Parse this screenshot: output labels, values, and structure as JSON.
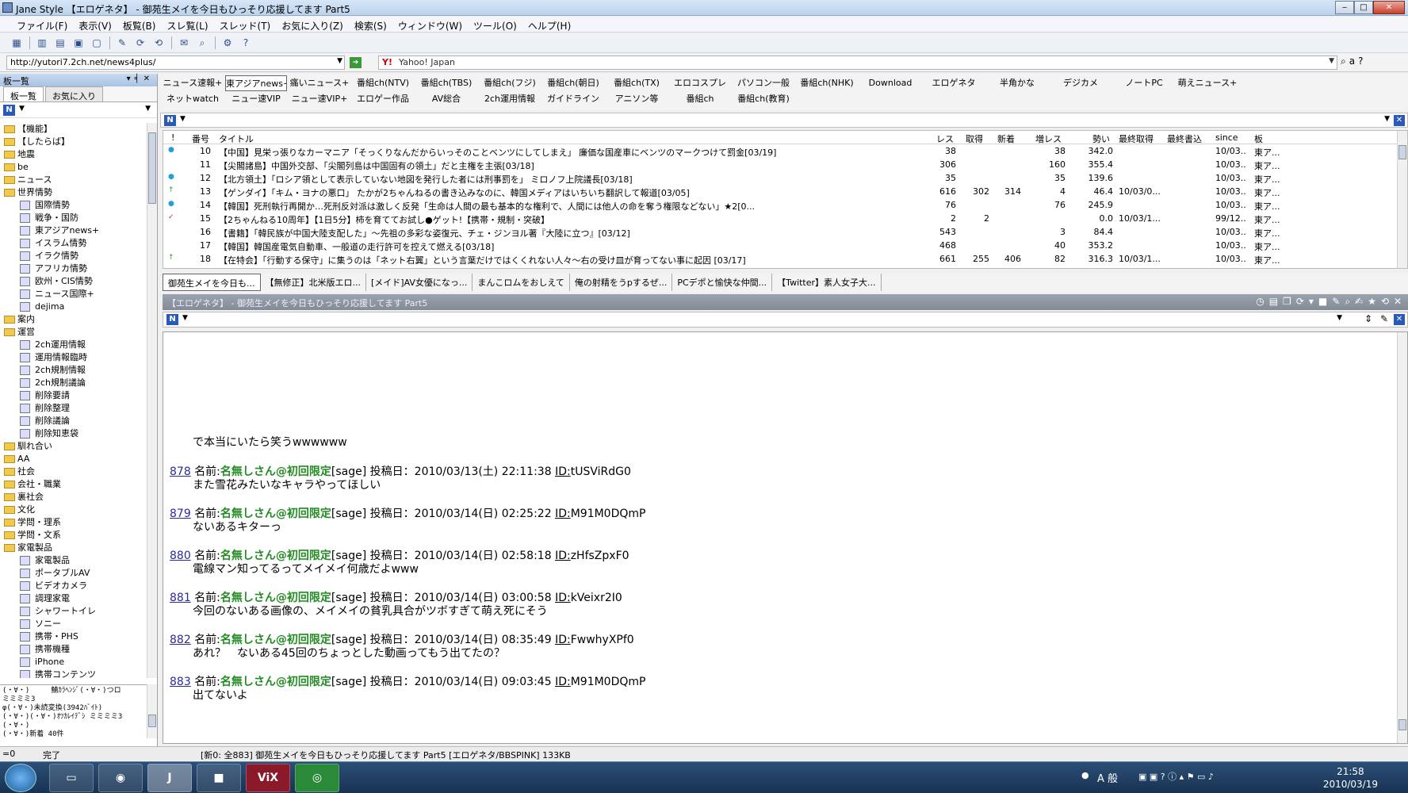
{
  "window": {
    "title": "Jane Style 【エロゲネタ】 - 御苑生メイを今日もひっそり応援してます Part5"
  },
  "menu": [
    "ファイル(F)",
    "表示(V)",
    "板覧(B)",
    "スレ覧(L)",
    "スレッド(T)",
    "お気に入り(Z)",
    "検索(S)",
    "ウィンドウ(W)",
    "ツール(O)",
    "ヘルプ(H)"
  ],
  "address": {
    "url": "http://yutori7.2ch.net/news4plus/",
    "search_engine": "Yahoo! Japan"
  },
  "leftpane": {
    "header": "板一覧",
    "tabs": [
      "板一覧",
      "お気に入り"
    ],
    "tree": [
      {
        "label": "【機能】",
        "level": 0
      },
      {
        "label": "【したらば】",
        "level": 0
      },
      {
        "label": "地震",
        "level": 0
      },
      {
        "label": "be",
        "level": 0
      },
      {
        "label": "ニュース",
        "level": 0
      },
      {
        "label": "世界情勢",
        "level": 0
      },
      {
        "label": "国際情勢",
        "level": 1
      },
      {
        "label": "戦争・国防",
        "level": 1
      },
      {
        "label": "東アジアnews+",
        "level": 1
      },
      {
        "label": "イスラム情勢",
        "level": 1
      },
      {
        "label": "イラク情勢",
        "level": 1
      },
      {
        "label": "アフリカ情勢",
        "level": 1
      },
      {
        "label": "欧州・CIS情勢",
        "level": 1
      },
      {
        "label": "ニュース国際+",
        "level": 1
      },
      {
        "label": "dejima",
        "level": 1
      },
      {
        "label": "案内",
        "level": 0
      },
      {
        "label": "運営",
        "level": 0
      },
      {
        "label": "2ch運用情報",
        "level": 1
      },
      {
        "label": "運用情報臨時",
        "level": 1
      },
      {
        "label": "2ch規制情報",
        "level": 1
      },
      {
        "label": "2ch規制議論",
        "level": 1
      },
      {
        "label": "削除要請",
        "level": 1
      },
      {
        "label": "削除整理",
        "level": 1
      },
      {
        "label": "削除議論",
        "level": 1
      },
      {
        "label": "削除知恵袋",
        "level": 1
      },
      {
        "label": "馴れ合い",
        "level": 0
      },
      {
        "label": "AA",
        "level": 0
      },
      {
        "label": "社会",
        "level": 0
      },
      {
        "label": "会社・職業",
        "level": 0
      },
      {
        "label": "裏社会",
        "level": 0
      },
      {
        "label": "文化",
        "level": 0
      },
      {
        "label": "学問・理系",
        "level": 0
      },
      {
        "label": "学問・文系",
        "level": 0
      },
      {
        "label": "家電製品",
        "level": 0
      },
      {
        "label": "家電製品",
        "level": 1
      },
      {
        "label": "ポータブルAV",
        "level": 1
      },
      {
        "label": "ビデオカメラ",
        "level": 1
      },
      {
        "label": "調理家電",
        "level": 1
      },
      {
        "label": "シャワートイレ",
        "level": 1
      },
      {
        "label": "ソニー",
        "level": 1
      },
      {
        "label": "携帯・PHS",
        "level": 1
      },
      {
        "label": "携帯機種",
        "level": 1
      },
      {
        "label": "iPhone",
        "level": 1
      },
      {
        "label": "携帯コンテンツ",
        "level": 1
      }
    ],
    "log": "(・∀・)     鯖ｶﾗﾍﾝｼﾞ(・∀・)つロ\nミミミミ3\nφ(・∀・)未読変換(3942ﾊﾞｲﾄ)\n(・∀・)(・∀・)ｵﾂｶﾚｲﾃﾞｼ ミミミミ3\n(・∀・)\n(・∀・)新着 40件"
  },
  "board_tabs": {
    "row1": [
      "ニュース速報+",
      "東アジアnews+",
      "痛いニュース+",
      "番組ch(NTV)",
      "番組ch(TBS)",
      "番組ch(フジ)",
      "番組ch(朝日)",
      "番組ch(TX)",
      "エロコスプレ",
      "パソコン一般",
      "番組ch(NHK)",
      "Download",
      "エロゲネタ",
      "半角かな",
      "デジカメ",
      "ノートPC",
      "萌えニュース+"
    ],
    "row2": [
      "ネットwatch",
      "ニュー速VIP",
      "ニュー速VIP+",
      "エロゲー作品",
      "AV総合",
      "2ch運用情報",
      "ガイドライン",
      "アニソン等",
      "番組ch",
      "番組ch(教育)"
    ]
  },
  "threadlist": {
    "columns": {
      "mark": "!",
      "num": "番号",
      "title": "タイトル",
      "res": "レス",
      "got": "取得",
      "new": "新着",
      "inc": "増レス",
      "speed": "勢い",
      "last_get": "最終取得",
      "last_write": "最終書込",
      "since": "since",
      "board": "板"
    },
    "rows": [
      {
        "mark": "●",
        "mark_color": "blue",
        "num": "10",
        "title": "【中国】見栄っ張りなカーマニア「そっくりなんだからいっそのことベンツにしてしまえ」 廉価な国産車にベンツのマークつけて罰金[03/19]",
        "res": "38",
        "got": "",
        "new": "",
        "inc": "38",
        "speed": "342.0",
        "last_get": "",
        "since": "10/03...",
        "board": "東ア..."
      },
      {
        "mark": "",
        "mark_color": "",
        "num": "11",
        "title": "【尖閣諸島】中国外交部、「尖閣列島は中国固有の領土」だと主権を主張[03/18]",
        "res": "306",
        "got": "",
        "new": "",
        "inc": "160",
        "speed": "355.4",
        "last_get": "",
        "since": "10/03...",
        "board": "東ア..."
      },
      {
        "mark": "●",
        "mark_color": "blue",
        "num": "12",
        "title": "【北方領土】「ロシア領として表示していない地図を発行した者には刑事罰を」 ミロノフ上院議長[03/18]",
        "res": "35",
        "got": "",
        "new": "",
        "inc": "35",
        "speed": "139.6",
        "last_get": "",
        "since": "10/03...",
        "board": "東ア..."
      },
      {
        "mark": "↑",
        "mark_color": "green",
        "num": "13",
        "title": "【ゲンダイ】「キム・ヨナの悪口」 たかが2ちゃんねるの書き込みなのに、韓国メディアはいちいち翻訳して報道[03/05]",
        "res": "616",
        "got": "302",
        "new": "314",
        "inc": "4",
        "speed": "46.4",
        "last_get": "10/03/0...",
        "since": "10/03...",
        "board": "東ア..."
      },
      {
        "mark": "●",
        "mark_color": "blue",
        "num": "14",
        "title": "【韓国】死刑執行再開か…死刑反対派は激しく反発「生命は人間の最も基本的な権利で、人間には他人の命を奪う権限などない」★2[0...",
        "res": "76",
        "got": "",
        "new": "",
        "inc": "76",
        "speed": "245.9",
        "last_get": "",
        "since": "10/03...",
        "board": "東ア..."
      },
      {
        "mark": "✓",
        "mark_color": "red",
        "num": "15",
        "title": "【2ちゃんねる10周年】【1日5分】柿を育ててお試し●ゲット!【携帯・規制・突破】",
        "res": "2",
        "got": "2",
        "new": "",
        "inc": "",
        "speed": "0.0",
        "last_get": "10/03/1...",
        "since": "99/12...",
        "board": "東ア..."
      },
      {
        "mark": "",
        "mark_color": "",
        "num": "16",
        "title": "【書籍】「韓民族が中国大陸支配した」～先祖の多彩な姿復元、チェ・ジンヨル著『大陸に立つ』[03/12]",
        "res": "543",
        "got": "",
        "new": "",
        "inc": "3",
        "speed": "84.4",
        "last_get": "",
        "since": "10/03...",
        "board": "東ア..."
      },
      {
        "mark": "",
        "mark_color": "",
        "num": "17",
        "title": "【韓国】韓国産電気自動車、一般道の走行許可を控えて燃える[03/18]",
        "res": "468",
        "got": "",
        "new": "",
        "inc": "40",
        "speed": "353.2",
        "last_get": "",
        "since": "10/03...",
        "board": "東ア..."
      },
      {
        "mark": "↑",
        "mark_color": "green",
        "num": "18",
        "title": "【在特会】「行動する保守」に集うのは「ネット右翼」という言葉だけではくくれない人々～右の受け皿が育ってない事に起因 [03/17]",
        "res": "661",
        "got": "255",
        "new": "406",
        "inc": "82",
        "speed": "316.3",
        "last_get": "10/03/1...",
        "since": "10/03...",
        "board": "東ア..."
      }
    ]
  },
  "thread_tabs": [
    "御苑生メイを今日も...",
    "【無修正】北米版エロ...",
    "[メイド]AV女優になっ...",
    "まんこロムをおしえて",
    "俺の射精をうpするぜ...",
    "PCデポと愉快な仲間...",
    "【Twitter】素人女子大..."
  ],
  "viewer": {
    "title": "【エロゲネタ】 - 御苑生メイを今日もひっそり応援してます Part5",
    "pre_line": "で本当にいたら笑うwwwwww",
    "posts": [
      {
        "num": "878",
        "label": "名前:",
        "name": "名無しさん@初回限定",
        "mail": "[sage]",
        "date": "投稿日：2010/03/13(土) 22:11:38",
        "id_label": "ID:",
        "id": "tUSViRdG0",
        "body": "また雪花みたいなキャラやってほしい"
      },
      {
        "num": "879",
        "label": "名前:",
        "name": "名無しさん@初回限定",
        "mail": "[sage]",
        "date": "投稿日：2010/03/14(日) 02:25:22",
        "id_label": "ID:",
        "id": "M91M0DQmP",
        "body": "ないあるキターっ"
      },
      {
        "num": "880",
        "label": "名前:",
        "name": "名無しさん@初回限定",
        "mail": "[sage]",
        "date": "投稿日：2010/03/14(日) 02:58:18",
        "id_label": "ID:",
        "id": "zHfsZpxF0",
        "body": "電線マン知ってるってメイメイ何歳だよwww"
      },
      {
        "num": "881",
        "label": "名前:",
        "name": "名無しさん@初回限定",
        "mail": "[sage]",
        "date": "投稿日：2010/03/14(日) 03:00:58",
        "id_label": "ID:",
        "id": "kVeixr2I0",
        "body": "今回のないある画像の、メイメイの貧乳具合がツボすぎて萌え死にそう"
      },
      {
        "num": "882",
        "label": "名前:",
        "name": "名無しさん@初回限定",
        "mail": "[sage]",
        "date": "投稿日：2010/03/14(日) 08:35:49",
        "id_label": "ID:",
        "id": "FwwhyXPf0",
        "body": "あれ？　ないある45回のちょっとした動画ってもう出てたの？"
      },
      {
        "num": "883",
        "label": "名前:",
        "name": "名無しさん@初回限定",
        "mail": "[sage]",
        "date": "投稿日：2010/03/14(日) 09:03:45",
        "id_label": "ID:",
        "id": "M91M0DQmP",
        "body": "出てないよ"
      }
    ]
  },
  "status": {
    "left": "=0",
    "mid": "完了",
    "right": "[新0: 全883] 御苑生メイを今日もひっそり応援してます Part5 [エロゲネタ/BBSPINK] 133KB"
  },
  "taskbar": {
    "tasks": [
      "",
      "",
      "",
      "J",
      "",
      "ViX",
      ""
    ],
    "ime": "A 般",
    "time": "21:58",
    "date": "2010/03/19"
  }
}
